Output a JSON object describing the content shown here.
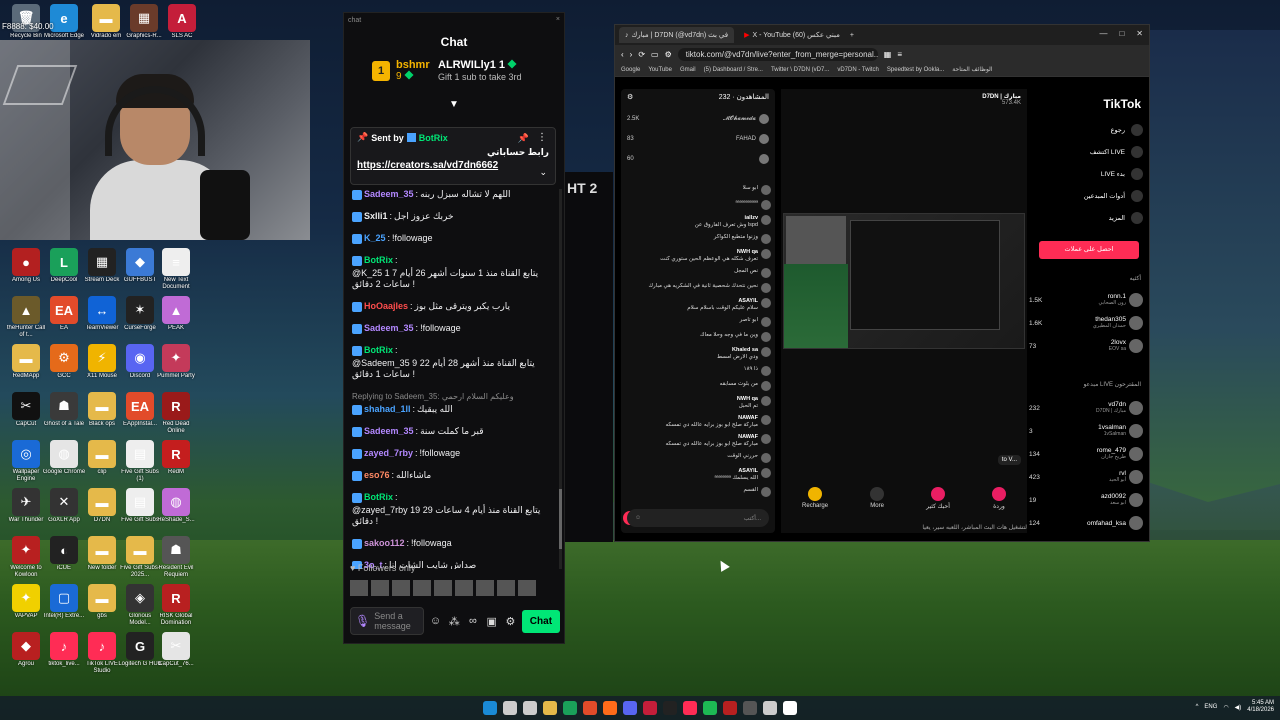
{
  "desktop": {
    "icons": [
      {
        "label": "Recycle Bin",
        "color": "#5b6b7a",
        "glyph": "🗑"
      },
      {
        "label": "Microsoft Edge",
        "color": "#1e8ad6",
        "glyph": "e"
      },
      {
        "label": "Vidrado em voce",
        "color": "#e5b94a",
        "glyph": "▬"
      },
      {
        "label": "Graphics-R...",
        "color": "#6a3b2a",
        "glyph": "▦"
      },
      {
        "label": "SLS AC",
        "color": "#c41e3a",
        "glyph": "A"
      },
      {
        "label": "Among Us",
        "color": "#b32020",
        "glyph": "●"
      },
      {
        "label": "DeepCool",
        "color": "#1aa05a",
        "glyph": "L"
      },
      {
        "label": "Stream Deck",
        "color": "#222",
        "glyph": "▦"
      },
      {
        "label": "GUFFBUST",
        "color": "#3b7ad6",
        "glyph": "◆"
      },
      {
        "label": "New Text Document",
        "color": "#eee",
        "glyph": "≡"
      },
      {
        "label": "theHunter Call of t...",
        "color": "#6b5a2a",
        "glyph": "▲"
      },
      {
        "label": "EA",
        "color": "#e24b2a",
        "glyph": "EA"
      },
      {
        "label": "TeamViewer",
        "color": "#1063d6",
        "glyph": "↔"
      },
      {
        "label": "CurseForge",
        "color": "#222",
        "glyph": "✶"
      },
      {
        "label": "PEAK",
        "color": "#c06bd6",
        "glyph": "▲"
      },
      {
        "label": "RedMApp",
        "color": "#e5b94a",
        "glyph": "▬"
      },
      {
        "label": "GCC",
        "color": "#e56a1a",
        "glyph": "⚙"
      },
      {
        "label": "X11 Mouse",
        "color": "#f0b400",
        "glyph": "⚡"
      },
      {
        "label": "Discord",
        "color": "#5865f2",
        "glyph": "◉"
      },
      {
        "label": "Pummel Party",
        "color": "#c43a5a",
        "glyph": "✦"
      },
      {
        "label": "CapCut",
        "color": "#111",
        "glyph": "✂"
      },
      {
        "label": "Ghost of a Tale",
        "color": "#3a3a3a",
        "glyph": "☗"
      },
      {
        "label": "Black ops",
        "color": "#e5b94a",
        "glyph": "▬"
      },
      {
        "label": "EAppInstal...",
        "color": "#e24b2a",
        "glyph": "EA"
      },
      {
        "label": "Red Dead Online",
        "color": "#9a1a1a",
        "glyph": "R"
      },
      {
        "label": "Wallpaper Engine",
        "color": "#1a6ad6",
        "glyph": "◎"
      },
      {
        "label": "Google Chrome",
        "color": "#e5e5e5",
        "glyph": "◍"
      },
      {
        "label": "clip",
        "color": "#e5b94a",
        "glyph": "▬"
      },
      {
        "label": "Five Gift Subs (1)",
        "color": "#eee",
        "glyph": "▤"
      },
      {
        "label": "RedM",
        "color": "#c41e1e",
        "glyph": "R"
      },
      {
        "label": "War Thunder",
        "color": "#333",
        "glyph": "✈"
      },
      {
        "label": "GoXLR App",
        "color": "#333",
        "glyph": "✕"
      },
      {
        "label": "D7DN",
        "color": "#e5b94a",
        "glyph": "▬"
      },
      {
        "label": "Five Gift Subs",
        "color": "#eee",
        "glyph": "▤"
      },
      {
        "label": "ReShade_S...",
        "color": "#c06bd6",
        "glyph": "◍"
      },
      {
        "label": "Welcome to Kowloon",
        "color": "#b82020",
        "glyph": "✦"
      },
      {
        "label": "iCUE",
        "color": "#222",
        "glyph": "◐"
      },
      {
        "label": "New folder",
        "color": "#e5b94a",
        "glyph": "▬"
      },
      {
        "label": "Five Gift Subs-2025...",
        "color": "#e5b94a",
        "glyph": "▬"
      },
      {
        "label": "Resident Evil Requiem",
        "color": "#555",
        "glyph": "☗"
      },
      {
        "label": "VAPVAP",
        "color": "#f0d000",
        "glyph": "✦"
      },
      {
        "label": "Intel(R) Extre...",
        "color": "#1a6ad6",
        "glyph": "▢"
      },
      {
        "label": "gbs",
        "color": "#e5b94a",
        "glyph": "▬"
      },
      {
        "label": "Glorious Model...",
        "color": "#333",
        "glyph": "◈"
      },
      {
        "label": "RISK Global Domination",
        "color": "#b82020",
        "glyph": "R"
      },
      {
        "label": "Agrou",
        "color": "#b82020",
        "glyph": "◆"
      },
      {
        "label": "tiktok_live...",
        "color": "#ff2c55",
        "glyph": "♪"
      },
      {
        "label": "TikTok LIVE Studio",
        "color": "#ff2c55",
        "glyph": "♪"
      },
      {
        "label": "Logitech G HUB",
        "color": "#222",
        "glyph": "G"
      },
      {
        "label": "CapCut_76...",
        "color": "#e5e5e5",
        "glyph": "✂"
      }
    ],
    "overlay_text": "F8888: $40.00"
  },
  "chat": {
    "window_title": "chat",
    "heading": "Chat",
    "leader1": {
      "rank": "1",
      "name": "bshmr",
      "count": "9"
    },
    "leader2": {
      "name": "ALRWILly1",
      "count": "1",
      "sub": "Gift 1 sub to take 3rd"
    },
    "pinned": {
      "sent_by": "Sent by",
      "sender": "BotRix",
      "arabic": "رابط حساباتي",
      "link": "https://creators.sa/vd7dn6662"
    },
    "messages": [
      {
        "user": "Sadeem_35",
        "color": "#b388ff",
        "text": "اللهم لا تشاله سبزل ربنه"
      },
      {
        "user": "Sxlli1",
        "color": "#eee",
        "text": "خربك عزوز اجل"
      },
      {
        "user": "K_25",
        "color": "#4aa3ff",
        "text": "!followage"
      },
      {
        "user": "BotRix",
        "color": "#00e676",
        "text": "@K_25 1 يتابع القناة منذ 1 سنوات أشهر 26 أيام 7 ساعات 2 دقائق !"
      },
      {
        "user": "HoOaajles",
        "color": "#ff4d4d",
        "text": "يارب يكبر ويترقى مثل بوز"
      },
      {
        "user": "Sadeem_35",
        "color": "#b388ff",
        "text": "!followage"
      },
      {
        "user": "BotRix",
        "color": "#00e676",
        "text": "@Sadeem_35 9 يتابع القناة منذ أشهر 28 أيام 22 ساعات 1 دقائق !"
      },
      {
        "user": "shahad_1ll",
        "color": "#4aa3ff",
        "text": "الله يبقيك",
        "reply": "Replying to Sadeem_35: وعليكم السلام ارحمي"
      },
      {
        "user": "Sadeem_35",
        "color": "#b388ff",
        "text": "قبر ما كملت سنة"
      },
      {
        "user": "zayed_7rby",
        "color": "#b388ff",
        "text": "!followage"
      },
      {
        "user": "eso76",
        "color": "#ff8a65",
        "text": "ماشاءالله"
      },
      {
        "user": "BotRix",
        "color": "#00e676",
        "text": "@zayed_7rby 19 يتابع القناة منذ أيام 4 ساعات 29 دقائق !"
      },
      {
        "user": "sakoo112",
        "color": "#ce93d8",
        "text": "!followaga"
      },
      {
        "user": "3o_t",
        "color": "#b388ff",
        "text": "صداش شايب الشات انا"
      }
    ],
    "followers_only": "Followers only",
    "input_placeholder": "Send a message",
    "chat_button": "Chat"
  },
  "behind_window": {
    "text": "HT 2"
  },
  "browser": {
    "tabs": [
      {
        "label": "مبارك | D7DN (@vd7dn) في بث",
        "active": true
      },
      {
        "label": "X - YouTube مبني عكس (60)",
        "active": false
      }
    ],
    "url": "tiktok.com/@vd7dn/live?enter_from_merge=personal...",
    "bookmarks": [
      "Google",
      "YouTube",
      "Gmail",
      "(5) Dashboard / Stre...",
      "Twitter \\ D7DN (vD7...",
      "vD7DN - Twitch",
      "Speedtest by Ookla...",
      "الوظائف المتاحة"
    ],
    "tiktok": {
      "viewers_label": "المشاهدون",
      "viewers_count": "232",
      "top_viewers": [
        {
          "name": "𝓜𝓞𝓱𝓪𝓶𝓮𝓭𝓪",
          "score": "2.5K"
        },
        {
          "name": "FAHAD",
          "score": "83"
        },
        {
          "name": "",
          "score": "60"
        }
      ],
      "messages": [
        {
          "name": "",
          "text": "ابو سلا"
        },
        {
          "name": "",
          "text": "ᵃᵃᵃᵃᵃᵃᵃᵃᵃᵃᵃ"
        },
        {
          "name": "iallzv",
          "text": "وش تعرف الفاروق عن lspd"
        },
        {
          "name": "",
          "text": "وزنوا متطبع الكواكر"
        },
        {
          "name": "NWH qa",
          "text": "تعرف شكله هي الوعظم الحين ستوري كنت"
        },
        {
          "name": "",
          "text": "نص المجل"
        },
        {
          "name": "",
          "text": "نحين نتحدك شحصية ثانية في الشكريه هي مبارك"
        },
        {
          "name": "ASAYIL",
          "text": "سلام عليكم الوقت باسلام سلام"
        },
        {
          "name": "",
          "text": "ابو تاصر"
        },
        {
          "name": "",
          "text": "وين ما في وجه وحلا معاك"
        },
        {
          "name": "Khaled sa",
          "text": "ودي الارض امسط"
        },
        {
          "name": "",
          "text": "ذا ١٨٩"
        },
        {
          "name": "",
          "text": "من بلوت مسابقه"
        },
        {
          "name": "NWH qa",
          "text": "تم الحبل"
        },
        {
          "name": "NAWAF",
          "text": "مباركة صلح ابو بوز برايه عالله دي تمسكه"
        },
        {
          "name": "NAWAF",
          "text": "مباركة صلح ابو بوز برايه عالله دي تمسكه"
        },
        {
          "name": "",
          "text": "حررني الوقت"
        },
        {
          "name": "ASAYIL",
          "text": "ᵃᵃᵃᵃᵃᵃᵃᵃ الله يسلمك"
        },
        {
          "name": "",
          "text": "القسم"
        }
      ],
      "input_placeholder": "أكتب...",
      "streamer": "D7DN | مبارك",
      "streamer_likes": "573.4K",
      "tooltip": "to V...",
      "actions": [
        {
          "label": "Recharge",
          "color": "#f0b400"
        },
        {
          "label": "More",
          "color": "#333"
        },
        {
          "label": "أحبك كثير",
          "color": "#e91e63"
        },
        {
          "label": "وردة",
          "color": "#e91e63"
        }
      ],
      "bottom_text": "لتشغيل هات البث المباشر، اللعبه سير، يعيا",
      "logo": "TikTok",
      "nav": [
        {
          "label": "رجوع"
        },
        {
          "label": "اكتشف LIVE"
        },
        {
          "label": "LIVE بدء"
        },
        {
          "label": "أدوات المبدعين"
        },
        {
          "label": "المزيد"
        }
      ],
      "rewards_button": "احصل على عملات",
      "top_section": "أكثيه",
      "top_users": [
        {
          "name": "ronn.1",
          "sub": "رون الصحابي",
          "count": "1.5K"
        },
        {
          "name": "thedan305",
          "sub": "حمدان المطيري",
          "count": "1.6K"
        },
        {
          "name": "2lovx",
          "sub": "EOV sa",
          "count": "73"
        }
      ],
      "suggested_section": "مبدعو LIVE المقترحون",
      "suggested": [
        {
          "name": "vd7dn",
          "sub": "D7DN | مبارك",
          "count": "232"
        },
        {
          "name": "1vsalman",
          "sub": "1vSalman",
          "count": "3"
        },
        {
          "name": "rome_479",
          "sub": "طريح جازان",
          "count": "134"
        },
        {
          "name": "rvl",
          "sub": "أبو الحيد",
          "count": "423"
        },
        {
          "name": "azd0092",
          "sub": "ابو سعد",
          "count": "19"
        },
        {
          "name": "omfahad_ksa",
          "sub": "",
          "count": "124"
        }
      ]
    }
  },
  "taskbar": {
    "apps": [
      "#1a8ad6",
      "#ccc",
      "#ccc",
      "#e5b94a",
      "#1aa05a",
      "#e24b2a",
      "#ff6b1a",
      "#5865f2",
      "#c41e3a",
      "#222",
      "#ff2c55",
      "#1db954",
      "#b82020",
      "#555",
      "#ccc",
      "#fff"
    ],
    "lang": "ENG",
    "time": "5:45 AM",
    "date": "4/18/2026"
  }
}
